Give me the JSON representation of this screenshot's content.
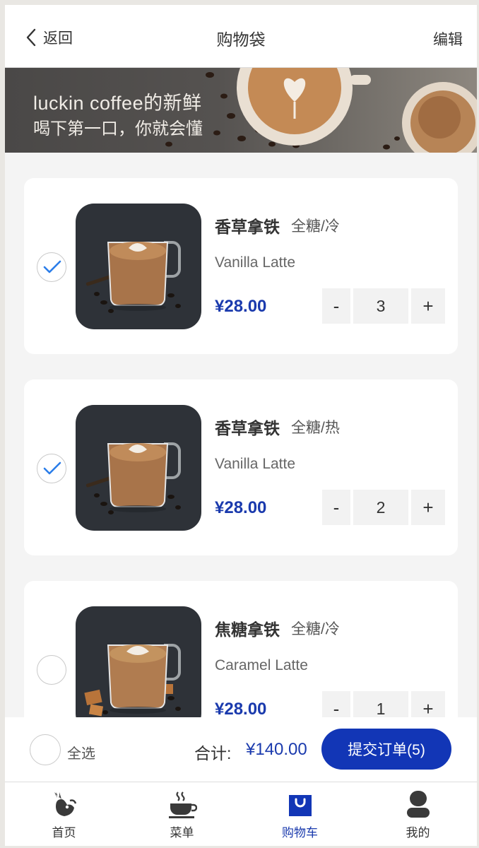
{
  "header": {
    "back_label": "返回",
    "title": "购物袋",
    "edit_label": "编辑"
  },
  "banner": {
    "line1": "luckin coffee的新鲜",
    "line2": "喝下第一口，你就会懂"
  },
  "cart": {
    "items": [
      {
        "name": "香草拿铁",
        "spec": "全糖/冷",
        "en_name": "Vanilla Latte",
        "price": "¥28.00",
        "quantity": "3",
        "minus": "-",
        "plus": "+",
        "checked": true
      },
      {
        "name": "香草拿铁",
        "spec": "全糖/热",
        "en_name": "Vanilla Latte",
        "price": "¥28.00",
        "quantity": "2",
        "minus": "-",
        "plus": "+",
        "checked": true
      },
      {
        "name": "焦糖拿铁",
        "spec": "全糖/冷",
        "en_name": "Caramel Latte",
        "price": "¥28.00",
        "quantity": "1",
        "minus": "-",
        "plus": "+",
        "checked": false
      }
    ]
  },
  "summary": {
    "select_all_label": "全选",
    "total_label": "合计:",
    "total_value": "¥140.00",
    "submit_label": "提交订单(5)"
  },
  "tabbar": {
    "tabs": [
      {
        "label": "首页",
        "icon": "deer-logo-icon",
        "active": false
      },
      {
        "label": "菜单",
        "icon": "coffee-cup-icon",
        "active": false
      },
      {
        "label": "购物车",
        "icon": "shopping-bag-icon",
        "active": true
      },
      {
        "label": "我的",
        "icon": "user-icon",
        "active": false
      }
    ]
  },
  "colors": {
    "accent": "#1236b6",
    "price": "#1a3aad",
    "check": "#2b7de9"
  }
}
